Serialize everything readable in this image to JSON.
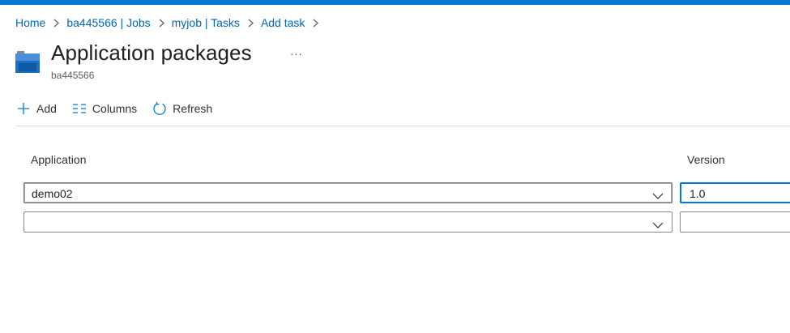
{
  "breadcrumb": [
    {
      "label": "Home"
    },
    {
      "label": "ba445566 | Jobs"
    },
    {
      "label": "myjob | Tasks"
    },
    {
      "label": "Add task"
    }
  ],
  "header": {
    "title": "Application packages",
    "more": "...",
    "subtitle": "ba445566"
  },
  "toolbar": {
    "add_label": "Add",
    "columns_label": "Columns",
    "refresh_label": "Refresh"
  },
  "table": {
    "columns": [
      "Application",
      "Version"
    ],
    "rows": [
      {
        "application": "demo02",
        "version": "1.0"
      },
      {
        "application": "",
        "version": ""
      }
    ]
  },
  "colors": {
    "accent": "#0078d4",
    "link": "#0066b8",
    "border": "#8a8886"
  },
  "icons": [
    "chevron-right-icon",
    "app-package-icon",
    "plus-icon",
    "columns-icon",
    "refresh-icon",
    "chevron-down-icon"
  ]
}
